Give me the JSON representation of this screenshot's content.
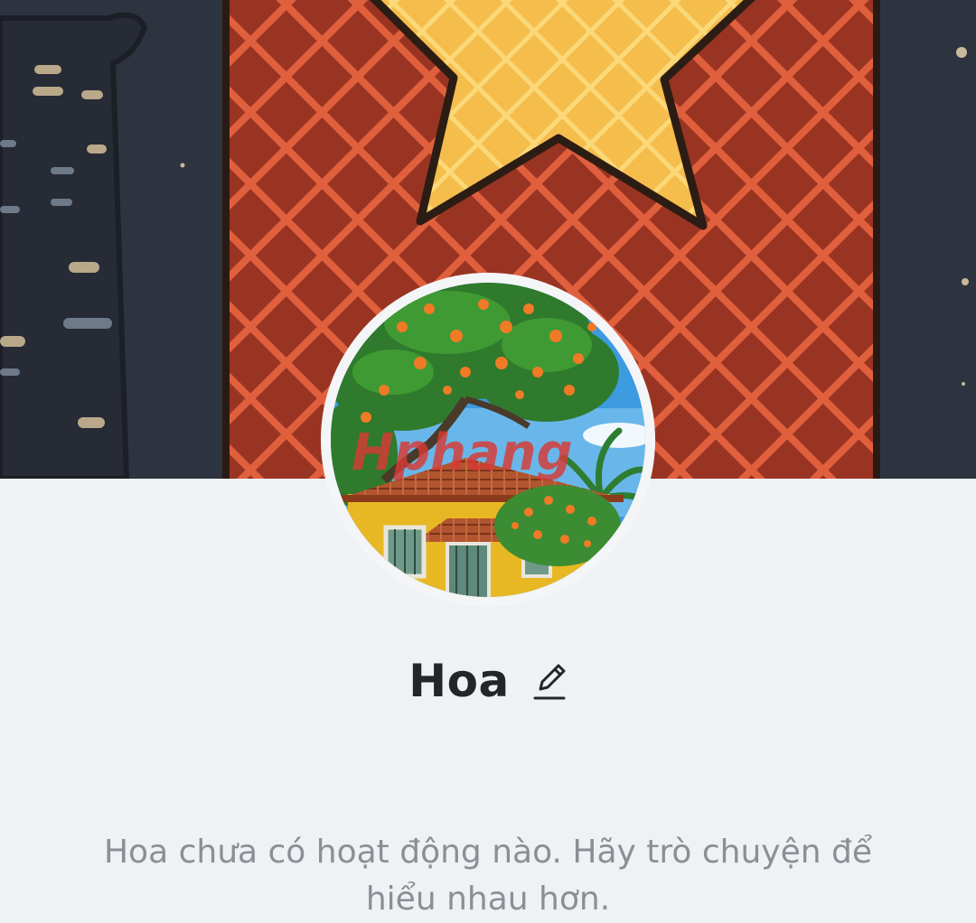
{
  "profile": {
    "name": "Hoa",
    "empty_activity_text": "Hoa chưa có hoạt động nào. Hãy trò chuyện để hiểu nhau hơn.",
    "avatar_watermark": "Hphang"
  },
  "icons": {
    "edit": "pencil-icon"
  },
  "colors": {
    "background": "#f0f1f4",
    "name_text": "#22252a",
    "secondary_text": "#8a8f96",
    "cover_night": "#2d3440",
    "flag_red": "#a33a2a",
    "star_yellow": "#f2b544"
  }
}
